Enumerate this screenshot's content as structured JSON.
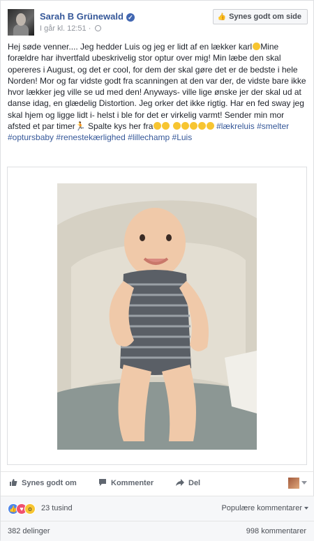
{
  "post": {
    "author": "Sarah B Grünewald",
    "time": "I går kl. 12:51",
    "like_page_label": "Synes godt om side",
    "text_lines": [
      "Hej søde venner.... Jeg hedder Luis og jeg er lidt af en lækker karl",
      "Mine forældre har ihvertfald ubeskrivelig stor optur over mig! Min læbe den skal opereres i August, og det er cool, for dem der skal gøre det er de bedste i hele Norden! Mor og far vidste godt fra scanningen at den var der, de vidste bare ikke hvor lækker jeg ville se ud med den! Anyways- ville lige ønske jer der skal ud at danse idag, en glædelig Distortion. Jeg orker det ikke rigtig. Har en fed sway jeg skal hjem og ligge lidt i- helst i ble for det er virkelig varmt! Sender min mor afsted et par timer",
      " Spalte kys her fra"
    ],
    "hashtags": [
      "#lækreluis",
      "#smelter",
      "#optursbaby",
      "#renestekærlighed",
      "#lillechamp",
      "#Luis"
    ]
  },
  "actions": {
    "like": "Synes godt om",
    "comment": "Kommenter",
    "share": "Del"
  },
  "reactions": {
    "count": "23 tusind",
    "sort_label": "Populære kommentarer"
  },
  "footer": {
    "shares": "382 delinger",
    "comments": "998 kommentarer"
  },
  "colors": {
    "link": "#365899",
    "like_blue": "#4e86ec",
    "love_red": "#f0506e",
    "wow_yellow": "#f7c531"
  }
}
